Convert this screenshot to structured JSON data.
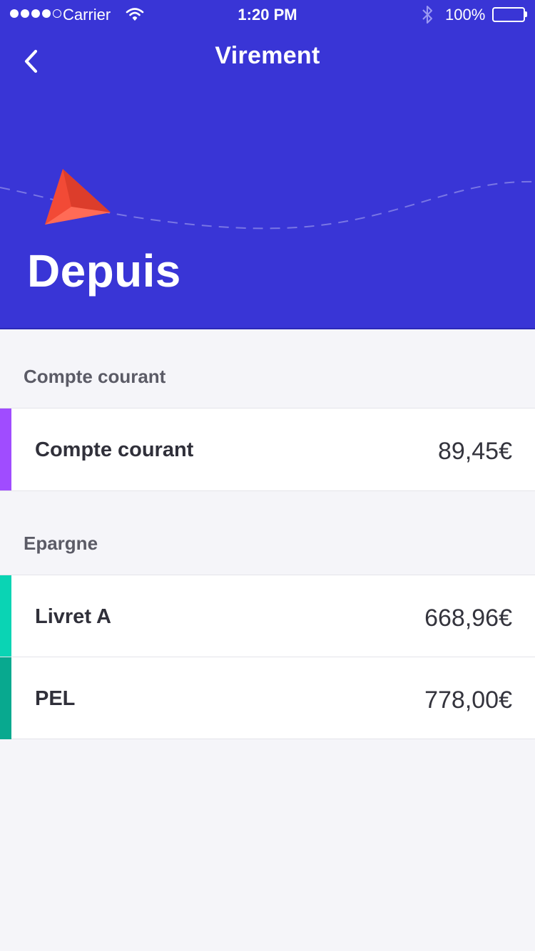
{
  "status_bar": {
    "carrier": "Carrier",
    "time": "1:20 PM",
    "battery": "100%",
    "icons": [
      "signal-dots",
      "wifi-icon",
      "bluetooth-icon",
      "battery-icon"
    ]
  },
  "nav": {
    "title": "Virement",
    "back_icon": "chevron-left-icon"
  },
  "hero": {
    "title": "Depuis",
    "illustration": "paper-plane-icon"
  },
  "sections": [
    {
      "title": "Compte courant",
      "accounts": [
        {
          "name": "Compte courant",
          "balance": "89,45€",
          "accent": "#a04cff"
        }
      ]
    },
    {
      "title": "Epargne",
      "accounts": [
        {
          "name": "Livret A",
          "balance": "668,96€",
          "accent": "#0ad4b4"
        },
        {
          "name": "PEL",
          "balance": "778,00€",
          "accent": "#08a98f"
        }
      ]
    }
  ],
  "colors": {
    "header": "#3935d6",
    "background": "#f5f5f9",
    "plane": "#f24a36"
  }
}
